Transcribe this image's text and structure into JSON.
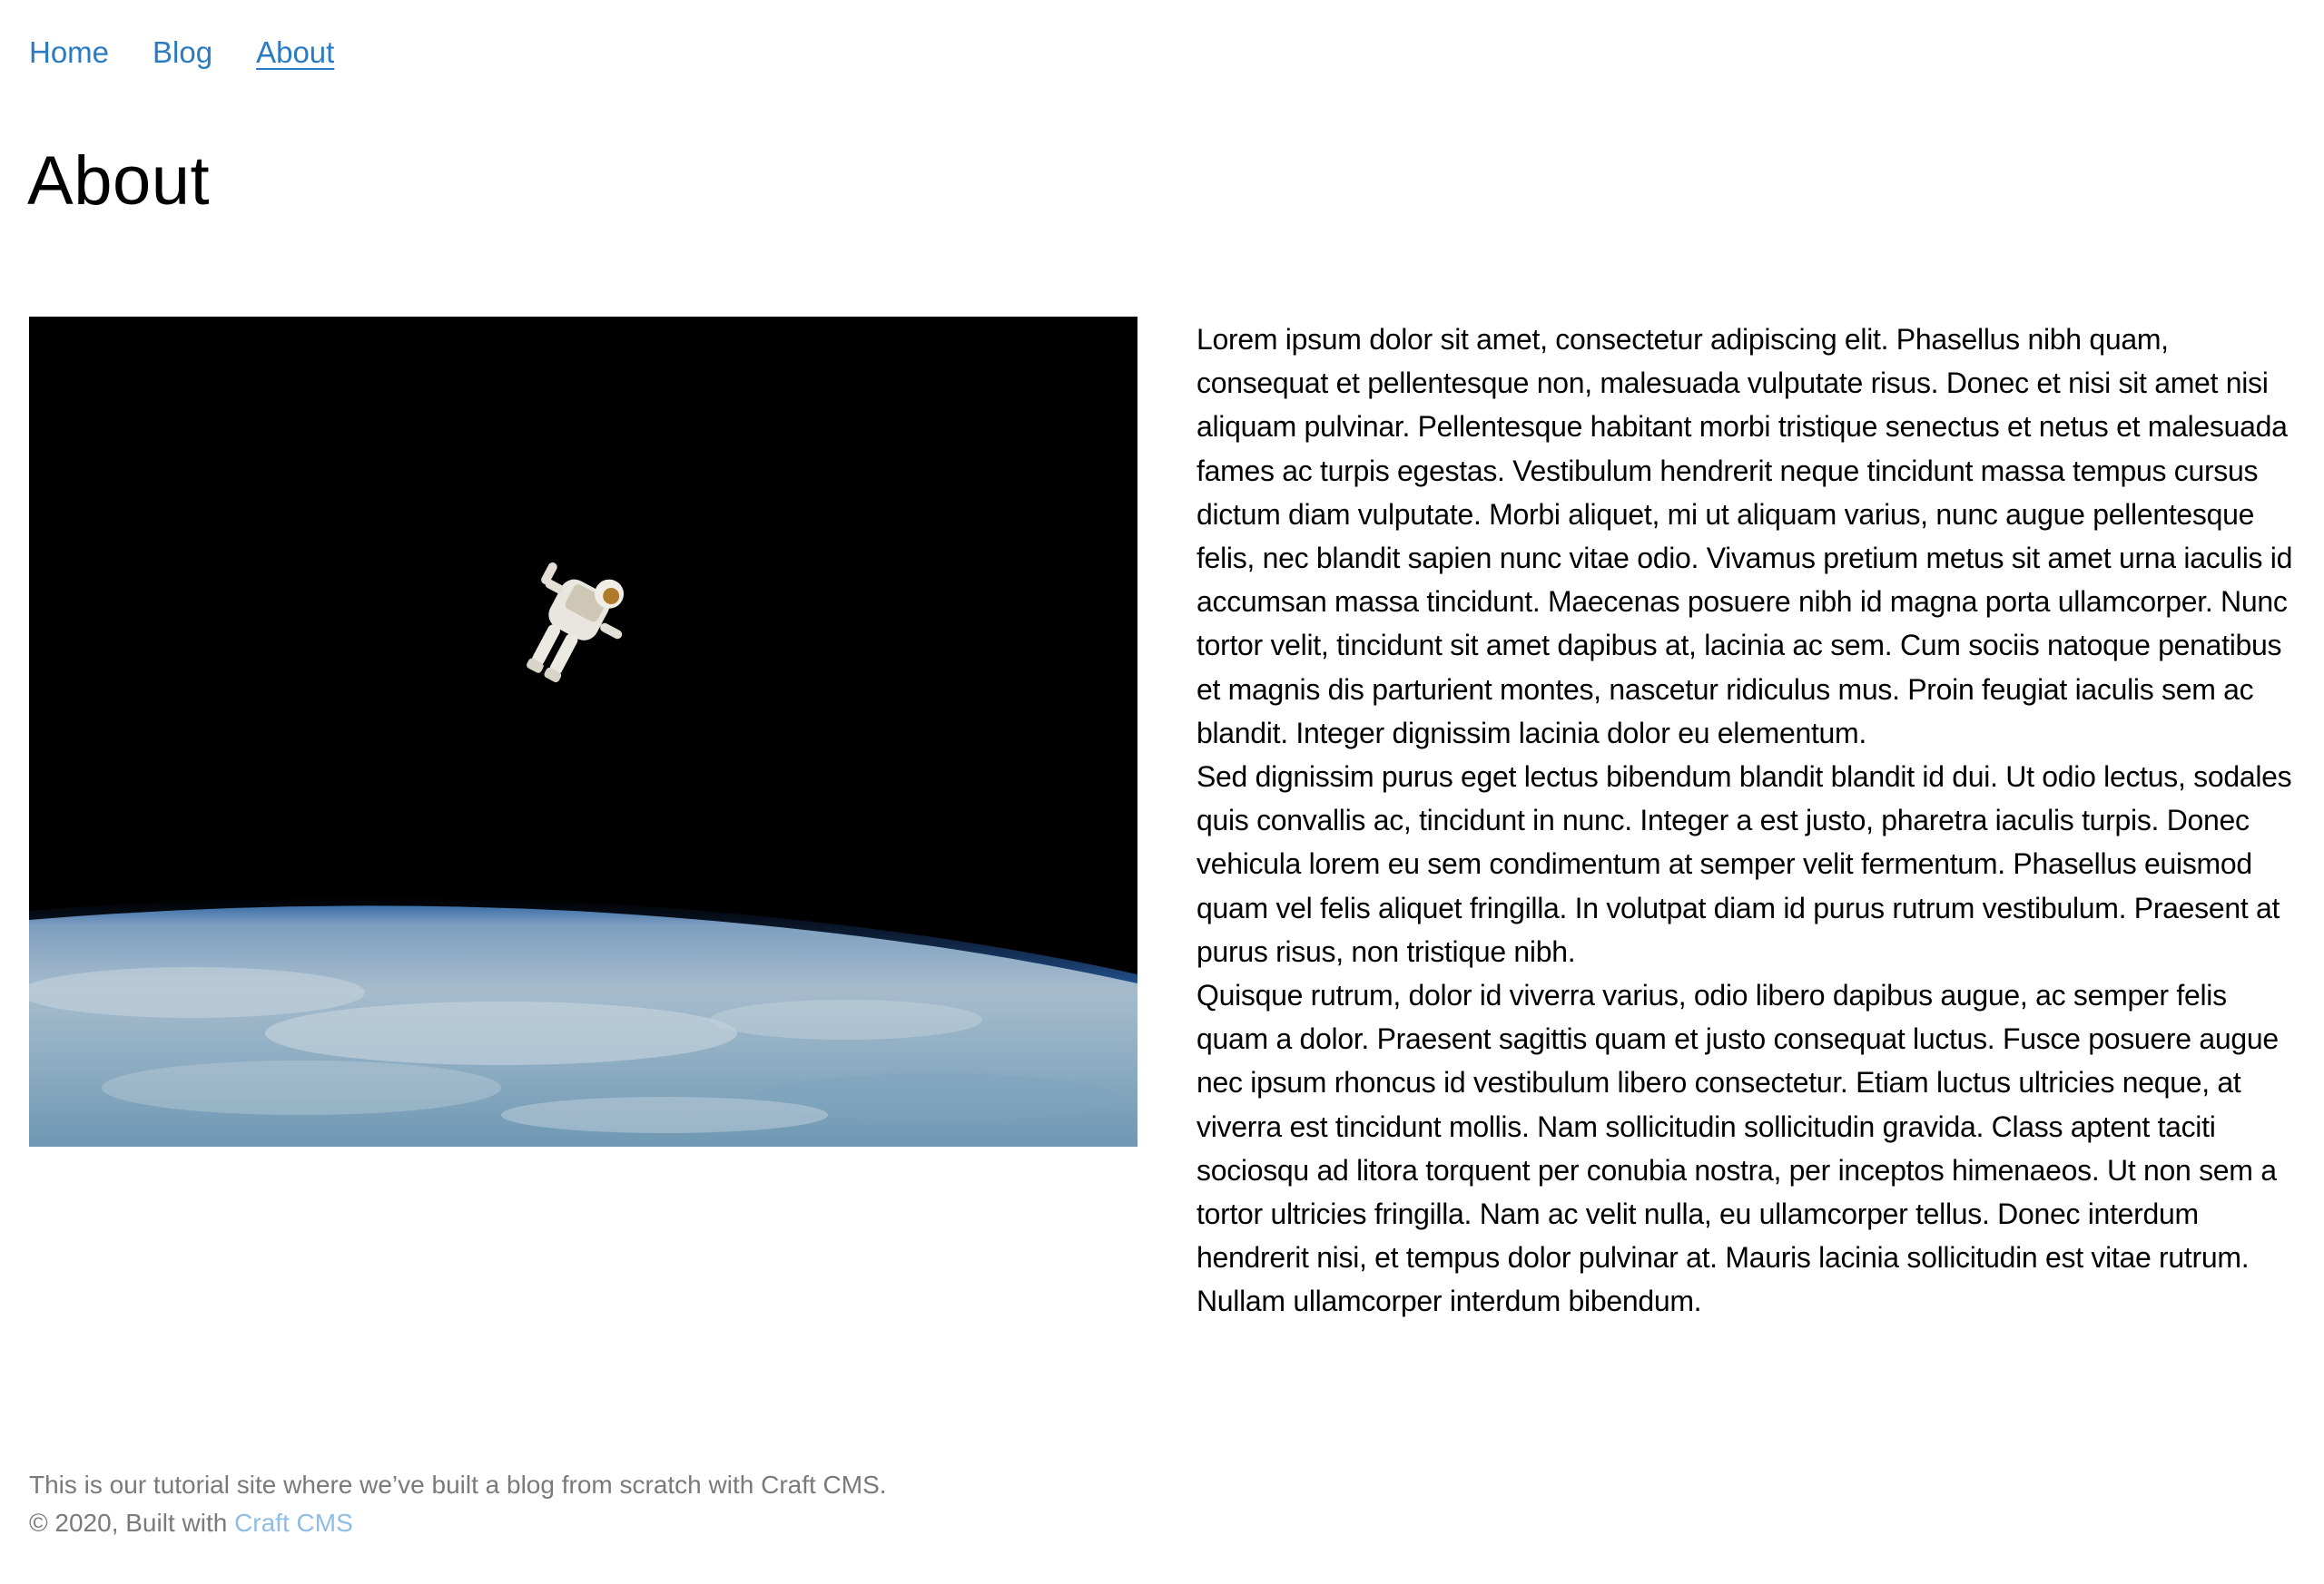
{
  "nav": {
    "items": [
      {
        "label": "Home"
      },
      {
        "label": "Blog"
      },
      {
        "label": "About"
      }
    ],
    "active": "About",
    "link_color": "#2a7bc4"
  },
  "page": {
    "title": "About"
  },
  "hero_image": {
    "subject": "astronaut floating in space above Earth"
  },
  "content": {
    "paragraphs": [
      "Lorem ipsum dolor sit amet, consectetur adipiscing elit. Phasellus nibh quam, consequat et pellentesque non, malesuada vulputate risus. Donec et nisi sit amet nisi aliquam pulvinar. Pellentesque habitant morbi tristique senectus et netus et malesuada fames ac turpis egestas. Vestibulum hendrerit neque tincidunt massa tempus cursus dictum diam vulputate. Morbi aliquet, mi ut aliquam varius, nunc augue pellentesque felis, nec blandit sapien nunc vitae odio. Vivamus pretium metus sit amet urna iaculis id accumsan massa tincidunt. Maecenas posuere nibh id magna porta ullamcorper. Nunc tortor velit, tincidunt sit amet dapibus at, lacinia ac sem. Cum sociis natoque penatibus et magnis dis parturient montes, nascetur ridiculus mus. Proin feugiat iaculis sem ac blandit. Integer dignissim lacinia dolor eu elementum.",
      "Sed dignissim purus eget lectus bibendum blandit blandit id dui. Ut odio lectus, sodales quis convallis ac, tincidunt in nunc. Integer a est justo, pharetra iaculis turpis. Donec vehicula lorem eu sem condimentum at semper velit fermentum. Phasellus euismod quam vel felis aliquet fringilla. In volutpat diam id purus rutrum vestibulum. Praesent at purus risus, non tristique nibh.",
      "Quisque rutrum, dolor id viverra varius, odio libero dapibus augue, ac semper felis quam a dolor. Praesent sagittis quam et justo consequat luctus. Fusce posuere augue nec ipsum rhoncus id vestibulum libero consectetur. Etiam luctus ultricies neque, at viverra est tincidunt mollis. Nam sollicitudin sollicitudin gravida. Class aptent taciti sociosqu ad litora torquent per conubia nostra, per inceptos himenaeos. Ut non sem a tortor ultricies fringilla. Nam ac velit nulla, eu ullamcorper tellus. Donec interdum hendrerit nisi, et tempus dolor pulvinar at. Mauris lacinia sollicitudin est vitae rutrum. Nullam ullamcorper interdum bibendum."
    ]
  },
  "footer": {
    "tagline": "This is our tutorial site where we’ve built a blog from scratch with Craft CMS.",
    "copyright_prefix": "© 2020, Built with ",
    "link_label": "Craft CMS"
  }
}
